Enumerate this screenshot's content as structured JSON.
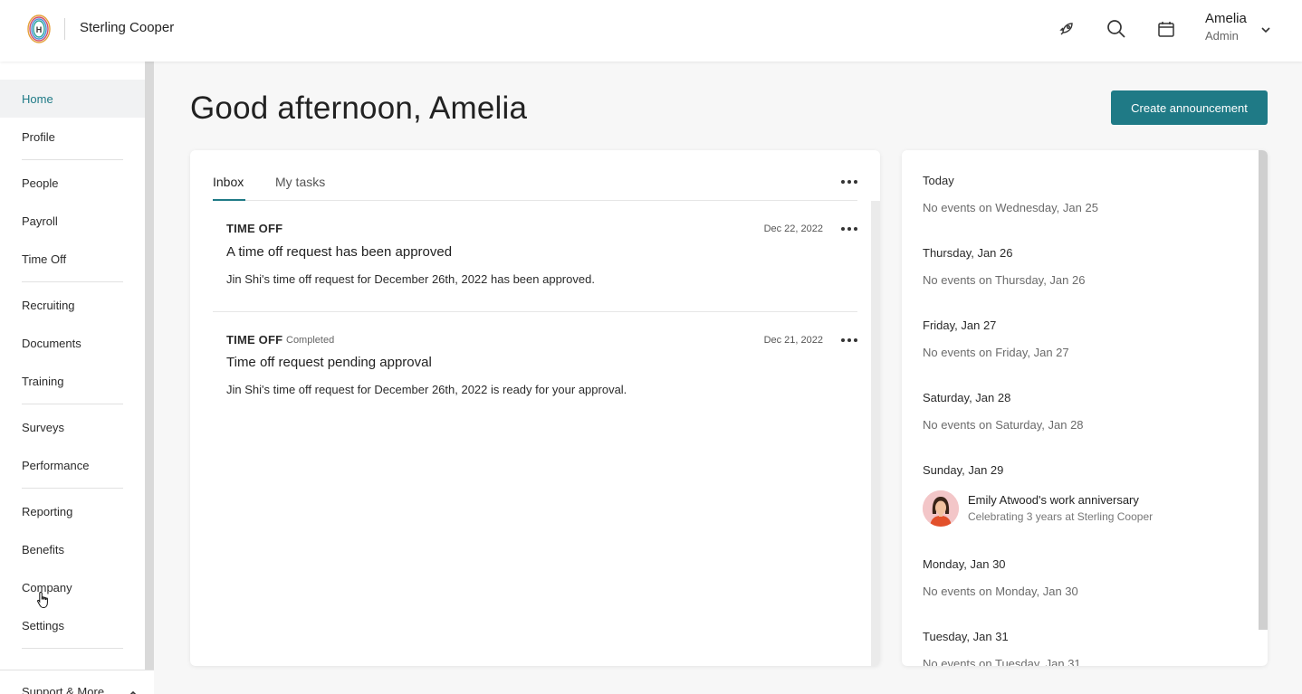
{
  "header": {
    "company": "Sterling Cooper",
    "logo_letter": "H",
    "icons": [
      "rocket-icon",
      "search-icon",
      "calendar-icon"
    ],
    "user": {
      "name": "Amelia",
      "role": "Admin"
    }
  },
  "sidebar": {
    "items": [
      {
        "label": "Home",
        "active": true
      },
      {
        "label": "Profile"
      },
      {
        "label": "People"
      },
      {
        "label": "Payroll"
      },
      {
        "label": "Time Off"
      },
      {
        "label": "Recruiting"
      },
      {
        "label": "Documents"
      },
      {
        "label": "Training"
      },
      {
        "label": "Surveys"
      },
      {
        "label": "Performance"
      },
      {
        "label": "Reporting"
      },
      {
        "label": "Benefits"
      },
      {
        "label": "Company"
      },
      {
        "label": "Settings"
      }
    ],
    "footer_label": "Support & More"
  },
  "main": {
    "greeting": "Good afternoon, Amelia",
    "create_button": "Create announcement"
  },
  "inbox": {
    "tabs": [
      "Inbox",
      "My tasks"
    ],
    "active_tab": "Inbox",
    "messages": [
      {
        "category": "TIME OFF",
        "status": "",
        "date": "Dec 22, 2022",
        "title": "A time off request has been approved",
        "body": "Jin Shi's time off request for December 26th, 2022 has been approved."
      },
      {
        "category": "TIME OFF",
        "status": "Completed",
        "date": "Dec 21, 2022",
        "title": "Time off request pending approval",
        "body": "Jin Shi's time off request for December 26th, 2022 is ready for your approval."
      }
    ]
  },
  "calendar": {
    "days": [
      {
        "heading": "Today",
        "text": "No events on Wednesday, Jan 25"
      },
      {
        "heading": "Thursday, Jan 26",
        "text": "No events on Thursday, Jan 26"
      },
      {
        "heading": "Friday, Jan 27",
        "text": "No events on Friday, Jan 27"
      },
      {
        "heading": "Saturday, Jan 28",
        "text": "No events on Saturday, Jan 28"
      },
      {
        "heading": "Sunday, Jan 29",
        "event": {
          "title": "Emily Atwood's work anniversary",
          "subtitle": "Celebrating 3 years at Sterling Cooper"
        }
      },
      {
        "heading": "Monday, Jan 30",
        "text": "No events on Monday, Jan 30"
      },
      {
        "heading": "Tuesday, Jan 31",
        "text": "No events on Tuesday, Jan 31"
      }
    ]
  },
  "colors": {
    "accent": "#1f7a86",
    "active_nav_bg": "#f1f2f3"
  }
}
